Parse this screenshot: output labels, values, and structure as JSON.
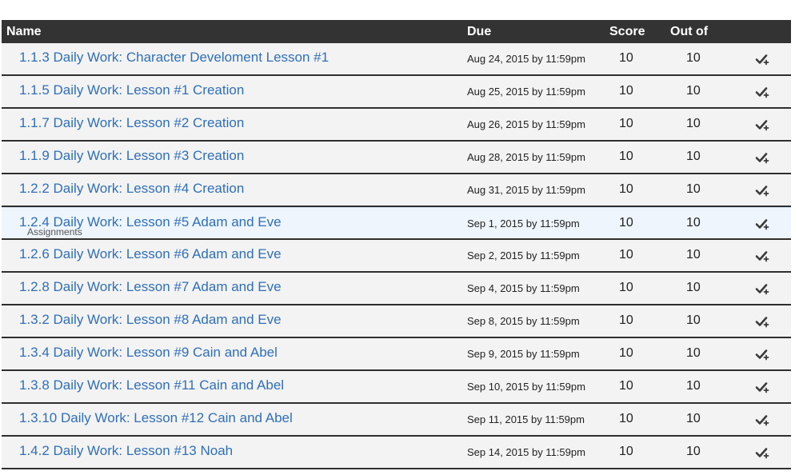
{
  "table": {
    "headers": {
      "name": "Name",
      "due": "Due",
      "score": "Score",
      "out_of": "Out of"
    },
    "rows": [
      {
        "name": "1.1.3 Daily Work: Character Develoment Lesson #1",
        "due": "Aug 24, 2015 by 11:59pm",
        "score": "10",
        "out_of": "10"
      },
      {
        "name": "1.1.5 Daily Work: Lesson #1 Creation",
        "due": "Aug 25, 2015 by 11:59pm",
        "score": "10",
        "out_of": "10"
      },
      {
        "name": "1.1.7 Daily Work: Lesson #2 Creation",
        "due": "Aug 26, 2015 by 11:59pm",
        "score": "10",
        "out_of": "10"
      },
      {
        "name": "1.1.9 Daily Work: Lesson #3 Creation",
        "due": "Aug 28, 2015 by 11:59pm",
        "score": "10",
        "out_of": "10"
      },
      {
        "name": "1.2.2 Daily Work: Lesson #4 Creation",
        "due": "Aug 31, 2015 by 11:59pm",
        "score": "10",
        "out_of": "10"
      },
      {
        "name": "1.2.4 Daily Work: Lesson #5 Adam and Eve",
        "due": "Sep 1, 2015 by 11:59pm",
        "score": "10",
        "out_of": "10"
      },
      {
        "name": "1.2.6 Daily Work: Lesson #6 Adam and Eve",
        "due": "Sep 2, 2015 by 11:59pm",
        "score": "10",
        "out_of": "10"
      },
      {
        "name": "1.2.8 Daily Work: Lesson #7 Adam and Eve",
        "due": "Sep 4, 2015 by 11:59pm",
        "score": "10",
        "out_of": "10"
      },
      {
        "name": "1.3.2 Daily Work: Lesson #8 Adam and Eve",
        "due": "Sep 8, 2015 by 11:59pm",
        "score": "10",
        "out_of": "10"
      },
      {
        "name": "1.3.4 Daily Work: Lesson #9 Cain and Abel",
        "due": "Sep 9, 2015 by 11:59pm",
        "score": "10",
        "out_of": "10"
      },
      {
        "name": "1.3.8 Daily Work: Lesson #11 Cain and Abel",
        "due": "Sep 10, 2015 by 11:59pm",
        "score": "10",
        "out_of": "10"
      },
      {
        "name": "1.3.10 Daily Work: Lesson #12 Cain and Abel",
        "due": "Sep 11, 2015 by 11:59pm",
        "score": "10",
        "out_of": "10"
      },
      {
        "name": "1.4.2 Daily Work: Lesson #13 Noah",
        "due": "Sep 14, 2015 by 11:59pm",
        "score": "10",
        "out_of": "10"
      }
    ],
    "row_icon": "check-plus-icon",
    "hovered_row_tooltip": "Assignments"
  },
  "colors": {
    "header_bg": "#333333",
    "link": "#2f6fb8",
    "row_bg": "#f3f3f3",
    "hover_bg": "#eef5fd"
  }
}
